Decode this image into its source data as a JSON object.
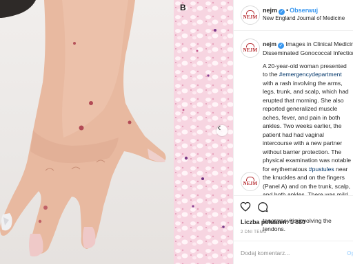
{
  "media": {
    "panel_b_label": "B",
    "hand_photo_icon": "hand-photo",
    "micrograph_icon": "micrograph",
    "prev_icon": "chevron-left-icon"
  },
  "header": {
    "username": "nejm",
    "separator": "•",
    "follow_label": "Obserwuj",
    "subtitle": "New England Journal of Medicine",
    "avatar_text": "NEJM"
  },
  "caption": {
    "username": "nejm",
    "line1": "Images in Clinical Medicine:",
    "line2": "Disseminated Gonococcal Infection",
    "body_pre": "A 20-year-old woman presented to the ",
    "hashtag1": "#emergencydepartment",
    "body_mid": " with a rash involving the arms, legs, trunk, and scalp, which had erupted that morning. She also reported generalized muscle aches, fever, and pain in both ankles. Two weeks earlier, the patient had had vaginal intercourse with a new partner without barrier protection. The physical examination was notable for erythematous ",
    "hashtag2": "#pustules",
    "body_post": " near the knuckles and on the fingers (Panel A) and on the trunk, scalp, and both ankles. There was mild swelling and pain on passive motion in the right ankle with tenosynovitis involving the tendons."
  },
  "actions": {
    "like_icon": "heart-icon",
    "comment_icon": "comment-icon"
  },
  "likes": {
    "label": "Liczba polubień:",
    "count": "1 860"
  },
  "timestamp": "2 DNI TEMU",
  "comment": {
    "placeholder": "Dodaj komentarz...",
    "post_label": "Opublikuj"
  },
  "colors": {
    "accent": "#3897f0",
    "hashtag": "#003569",
    "brand": "#b11f24",
    "muted": "#8e8e8e"
  }
}
